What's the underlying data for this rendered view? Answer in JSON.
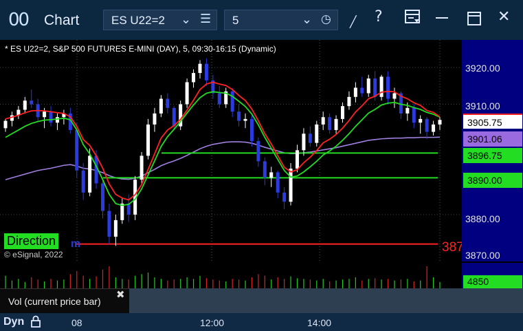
{
  "window": {
    "app_icon": "00",
    "title": "Chart",
    "icons": [
      "draw-tool-icon",
      "help-icon",
      "layout-icon",
      "maximize-icon",
      "close-icon"
    ]
  },
  "toolbar": {
    "symbol": "ES U22=2",
    "interval": "5",
    "help_glyph": "?",
    "close_glyph": "✕"
  },
  "chart": {
    "header": "* ES U22=2, S&P 500 FUTURES E-MINI (DAY), 5, 09:30-16:15 (Dynamic)",
    "copyright": "© eSignal, 2022",
    "direction_label": "Direction",
    "direction_suffix": "m",
    "overflow_price": "387",
    "price_ticks": [
      "3920.00",
      "3910.00",
      "3880.00",
      "3870.00"
    ],
    "price_tags": {
      "last": "3905.75",
      "ma_long": "3901.06",
      "level_high": "3896.75",
      "level_low": "3890.00"
    },
    "colors": {
      "up": "#ffffff",
      "down": "#2a3be0",
      "fast_ma": "#ff2222",
      "slow_ma": "#22dd22",
      "long_ma": "#a080e0",
      "level": "#22dd22",
      "support": "#ff2222"
    }
  },
  "volume": {
    "label": "Vol (current price bar)",
    "current_value": "4850",
    "close_glyph": "✖"
  },
  "time_axis": {
    "mode": "Dyn",
    "labels": [
      "08",
      "12:00",
      "14:00"
    ]
  },
  "chart_data": {
    "type": "candlestick",
    "symbol": "ES U22=2",
    "ylim": [
      3868,
      3926
    ],
    "ohlc": [
      [
        3903.5,
        3906.0,
        3902.5,
        3905.5
      ],
      [
        3905.5,
        3908.0,
        3904.0,
        3907.0
      ],
      [
        3907.0,
        3909.5,
        3906.0,
        3908.5
      ],
      [
        3908.5,
        3912.0,
        3907.5,
        3911.0
      ],
      [
        3911.0,
        3914.0,
        3909.0,
        3910.0
      ],
      [
        3910.0,
        3911.5,
        3905.5,
        3906.5
      ],
      [
        3906.5,
        3909.0,
        3903.5,
        3908.0
      ],
      [
        3908.0,
        3909.5,
        3904.0,
        3905.0
      ],
      [
        3905.0,
        3907.5,
        3903.0,
        3906.5
      ],
      [
        3906.5,
        3908.5,
        3904.5,
        3907.5
      ],
      [
        3907.5,
        3909.0,
        3902.0,
        3903.0
      ],
      [
        3903.0,
        3905.0,
        3890.0,
        3892.0
      ],
      [
        3892.0,
        3894.0,
        3884.0,
        3886.0
      ],
      [
        3886.0,
        3898.0,
        3885.0,
        3896.0
      ],
      [
        3896.0,
        3897.5,
        3887.0,
        3888.5
      ],
      [
        3888.5,
        3890.0,
        3879.0,
        3881.0
      ],
      [
        3881.0,
        3883.0,
        3872.0,
        3874.0
      ],
      [
        3874.0,
        3880.0,
        3871.5,
        3878.5
      ],
      [
        3878.5,
        3884.5,
        3877.5,
        3883.0
      ],
      [
        3883.0,
        3885.5,
        3878.0,
        3880.0
      ],
      [
        3880.0,
        3890.5,
        3878.5,
        3889.5
      ],
      [
        3889.5,
        3897.0,
        3888.0,
        3896.0
      ],
      [
        3896.0,
        3906.0,
        3895.0,
        3904.5
      ],
      [
        3904.5,
        3909.0,
        3902.5,
        3907.5
      ],
      [
        3907.5,
        3912.5,
        3906.5,
        3911.5
      ],
      [
        3911.5,
        3913.0,
        3907.5,
        3909.0
      ],
      [
        3909.0,
        3909.5,
        3903.0,
        3904.0
      ],
      [
        3904.0,
        3911.0,
        3903.0,
        3910.0
      ],
      [
        3910.0,
        3917.0,
        3909.0,
        3916.0
      ],
      [
        3916.0,
        3919.5,
        3914.5,
        3918.5
      ],
      [
        3918.5,
        3922.0,
        3917.0,
        3921.0
      ],
      [
        3921.0,
        3922.5,
        3915.0,
        3916.5
      ],
      [
        3916.5,
        3918.0,
        3911.5,
        3913.0
      ],
      [
        3913.0,
        3915.0,
        3909.0,
        3910.0
      ],
      [
        3910.0,
        3914.5,
        3909.0,
        3913.5
      ],
      [
        3913.5,
        3914.5,
        3906.5,
        3908.0
      ],
      [
        3908.0,
        3910.0,
        3904.0,
        3905.5
      ],
      [
        3905.5,
        3907.5,
        3903.5,
        3906.0
      ],
      [
        3906.0,
        3907.0,
        3898.5,
        3900.0
      ],
      [
        3900.0,
        3901.0,
        3893.0,
        3894.5
      ],
      [
        3894.5,
        3895.5,
        3888.0,
        3890.0
      ],
      [
        3890.0,
        3893.0,
        3887.5,
        3891.5
      ],
      [
        3891.5,
        3892.0,
        3884.5,
        3886.0
      ],
      [
        3886.0,
        3887.5,
        3881.5,
        3883.5
      ],
      [
        3883.5,
        3894.0,
        3882.5,
        3892.5
      ],
      [
        3892.5,
        3899.0,
        3891.5,
        3897.5
      ],
      [
        3897.5,
        3903.5,
        3896.0,
        3902.0
      ],
      [
        3902.0,
        3904.0,
        3898.5,
        3899.5
      ],
      [
        3899.5,
        3905.5,
        3898.5,
        3904.5
      ],
      [
        3904.5,
        3908.0,
        3903.0,
        3906.5
      ],
      [
        3906.5,
        3907.5,
        3902.0,
        3903.0
      ],
      [
        3903.0,
        3907.0,
        3902.0,
        3906.0
      ],
      [
        3906.0,
        3910.5,
        3905.0,
        3909.5
      ],
      [
        3909.5,
        3913.5,
        3908.5,
        3912.0
      ],
      [
        3912.0,
        3916.0,
        3910.5,
        3914.5
      ],
      [
        3914.5,
        3917.5,
        3912.0,
        3913.0
      ],
      [
        3913.0,
        3918.0,
        3912.0,
        3917.0
      ],
      [
        3917.0,
        3919.0,
        3911.0,
        3912.0
      ],
      [
        3912.0,
        3918.0,
        3911.0,
        3917.5
      ],
      [
        3917.5,
        3919.0,
        3910.0,
        3911.5
      ],
      [
        3911.5,
        3914.5,
        3909.0,
        3913.0
      ],
      [
        3913.0,
        3913.5,
        3906.0,
        3907.5
      ],
      [
        3907.5,
        3910.5,
        3905.5,
        3909.0
      ],
      [
        3909.0,
        3910.0,
        3903.5,
        3905.0
      ],
      [
        3905.0,
        3907.0,
        3902.0,
        3906.0
      ],
      [
        3906.0,
        3906.5,
        3900.5,
        3902.5
      ],
      [
        3902.5,
        3905.5,
        3901.5,
        3904.5
      ],
      [
        3904.5,
        3906.5,
        3903.0,
        3905.75
      ]
    ],
    "series": [
      {
        "name": "fast",
        "values": [
          3906.0,
          3906.5,
          3907.0,
          3907.7,
          3908.2,
          3908.3,
          3908.2,
          3908.0,
          3907.7,
          3907.5,
          3906.6,
          3904.0,
          3900.4,
          3898.8,
          3896.0,
          3892.6,
          3888.3,
          3885.5,
          3884.5,
          3884.0,
          3885.4,
          3888.2,
          3892.3,
          3896.5,
          3900.8,
          3903.0,
          3904.2,
          3905.9,
          3908.4,
          3911.1,
          3914.0,
          3915.5,
          3916.0,
          3915.5,
          3915.1,
          3914.0,
          3912.4,
          3911.0,
          3908.7,
          3905.5,
          3902.0,
          3899.2,
          3896.0,
          3892.9,
          3891.6,
          3892.2,
          3894.1,
          3895.6,
          3897.4,
          3899.5,
          3900.5,
          3901.8,
          3903.5,
          3905.6,
          3907.9,
          3909.6,
          3911.5,
          3912.2,
          3913.3,
          3913.5,
          3913.4,
          3912.2,
          3911.5,
          3910.4,
          3909.7,
          3908.3,
          3907.8,
          3906.6
        ]
      },
      {
        "name": "slow",
        "values": [
          3901.0,
          3902.0,
          3903.0,
          3904.0,
          3904.8,
          3905.3,
          3905.7,
          3905.8,
          3906.0,
          3906.2,
          3905.8,
          3903.0,
          3899.0,
          3896.5,
          3893.2,
          3889.5,
          3885.5,
          3883.0,
          3882.5,
          3882.8,
          3884.2,
          3887.0,
          3890.8,
          3894.6,
          3898.5,
          3901.2,
          3903.2,
          3905.3,
          3907.6,
          3909.8,
          3911.8,
          3913.0,
          3913.4,
          3913.2,
          3913.0,
          3912.2,
          3910.8,
          3909.4,
          3907.3,
          3904.4,
          3901.0,
          3898.0,
          3895.0,
          3892.0,
          3890.2,
          3890.5,
          3891.6,
          3893.0,
          3894.5,
          3896.2,
          3897.3,
          3898.6,
          3900.2,
          3902.0,
          3904.0,
          3905.8,
          3907.6,
          3908.6,
          3909.8,
          3910.3,
          3910.5,
          3910.0,
          3909.7,
          3909.1,
          3908.6,
          3907.8,
          3907.3,
          3906.5
        ]
      },
      {
        "name": "long",
        "values": [
          3889.5,
          3890.0,
          3890.5,
          3891.0,
          3891.5,
          3892.0,
          3892.3,
          3892.6,
          3893.0,
          3893.4,
          3893.6,
          3893.2,
          3892.6,
          3892.4,
          3892.0,
          3891.4,
          3890.6,
          3890.0,
          3889.7,
          3889.6,
          3889.9,
          3890.5,
          3891.4,
          3892.3,
          3893.3,
          3894.0,
          3894.6,
          3895.3,
          3896.1,
          3897.0,
          3897.9,
          3898.6,
          3899.1,
          3899.4,
          3899.7,
          3899.8,
          3899.8,
          3899.7,
          3899.4,
          3898.9,
          3898.3,
          3897.8,
          3897.3,
          3896.8,
          3896.6,
          3896.6,
          3896.8,
          3897.0,
          3897.3,
          3897.6,
          3897.9,
          3898.2,
          3898.6,
          3899.0,
          3899.4,
          3899.8,
          3900.2,
          3900.4,
          3900.6,
          3900.7,
          3900.8,
          3900.8,
          3900.9,
          3900.9,
          3901.0,
          3901.0,
          3901.0,
          3901.06
        ]
      }
    ],
    "levels": [
      3896.75,
      3890.0,
      3872.0
    ],
    "volume": [
      40,
      25,
      30,
      20,
      35,
      28,
      22,
      30,
      25,
      28,
      45,
      55,
      40,
      30,
      38,
      60,
      70,
      35,
      30,
      28,
      40,
      45,
      50,
      35,
      30,
      25,
      28,
      30,
      35,
      30,
      40,
      32,
      28,
      25,
      22,
      30,
      28,
      25,
      35,
      45,
      40,
      28,
      35,
      30,
      38,
      32,
      30,
      28,
      25,
      30,
      22,
      25,
      28,
      30,
      35,
      25,
      30,
      32,
      28,
      30,
      25,
      28,
      30,
      22,
      25,
      70,
      35,
      20
    ]
  }
}
